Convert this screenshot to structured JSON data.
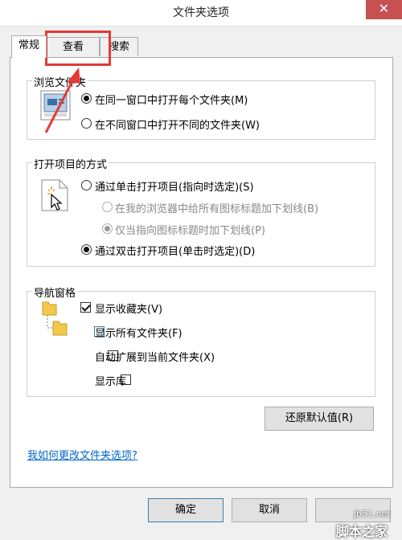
{
  "window": {
    "title": "文件夹选项",
    "close_label": "✕"
  },
  "tabs": [
    {
      "label": "常规",
      "active": true
    },
    {
      "label": "查看",
      "active": false
    },
    {
      "label": "搜索",
      "active": false
    }
  ],
  "browse_group": {
    "label": "浏览文件夹",
    "options": [
      {
        "label": "在同一窗口中打开每个文件夹(M)",
        "selected": true
      },
      {
        "label": "在不同窗口中打开不同的文件夹(W)",
        "selected": false
      }
    ]
  },
  "click_group": {
    "label": "打开项目的方式",
    "single_click": "通过单击打开项目(指向时选定)(S)",
    "sub_options": [
      {
        "label": "在我的浏览器中给所有图标标题加下划线(B)",
        "selected": false
      },
      {
        "label": "仅当指向图标标题时加下划线(P)",
        "selected": true
      }
    ],
    "double_click": "通过双击打开项目(单击时选定)(D)"
  },
  "nav_group": {
    "label": "导航窗格",
    "options": [
      {
        "label": "显示收藏夹(V)",
        "checked": true
      },
      {
        "label": "显示所有文件夹(F)",
        "checked": false
      },
      {
        "label": "自动扩展到当前文件夹(X)",
        "checked": false
      },
      {
        "label": "显示库",
        "checked": false
      }
    ]
  },
  "buttons": {
    "restore": "还原默认值(R)",
    "ok": "确定",
    "cancel": "取消"
  },
  "help_link": "我如何更改文件夹选项?",
  "watermark": {
    "site": "jb51.net",
    "name": "脚本之家"
  },
  "colors": {
    "annotation": "#e53935",
    "link": "#0066cc",
    "close": "#c75050"
  }
}
